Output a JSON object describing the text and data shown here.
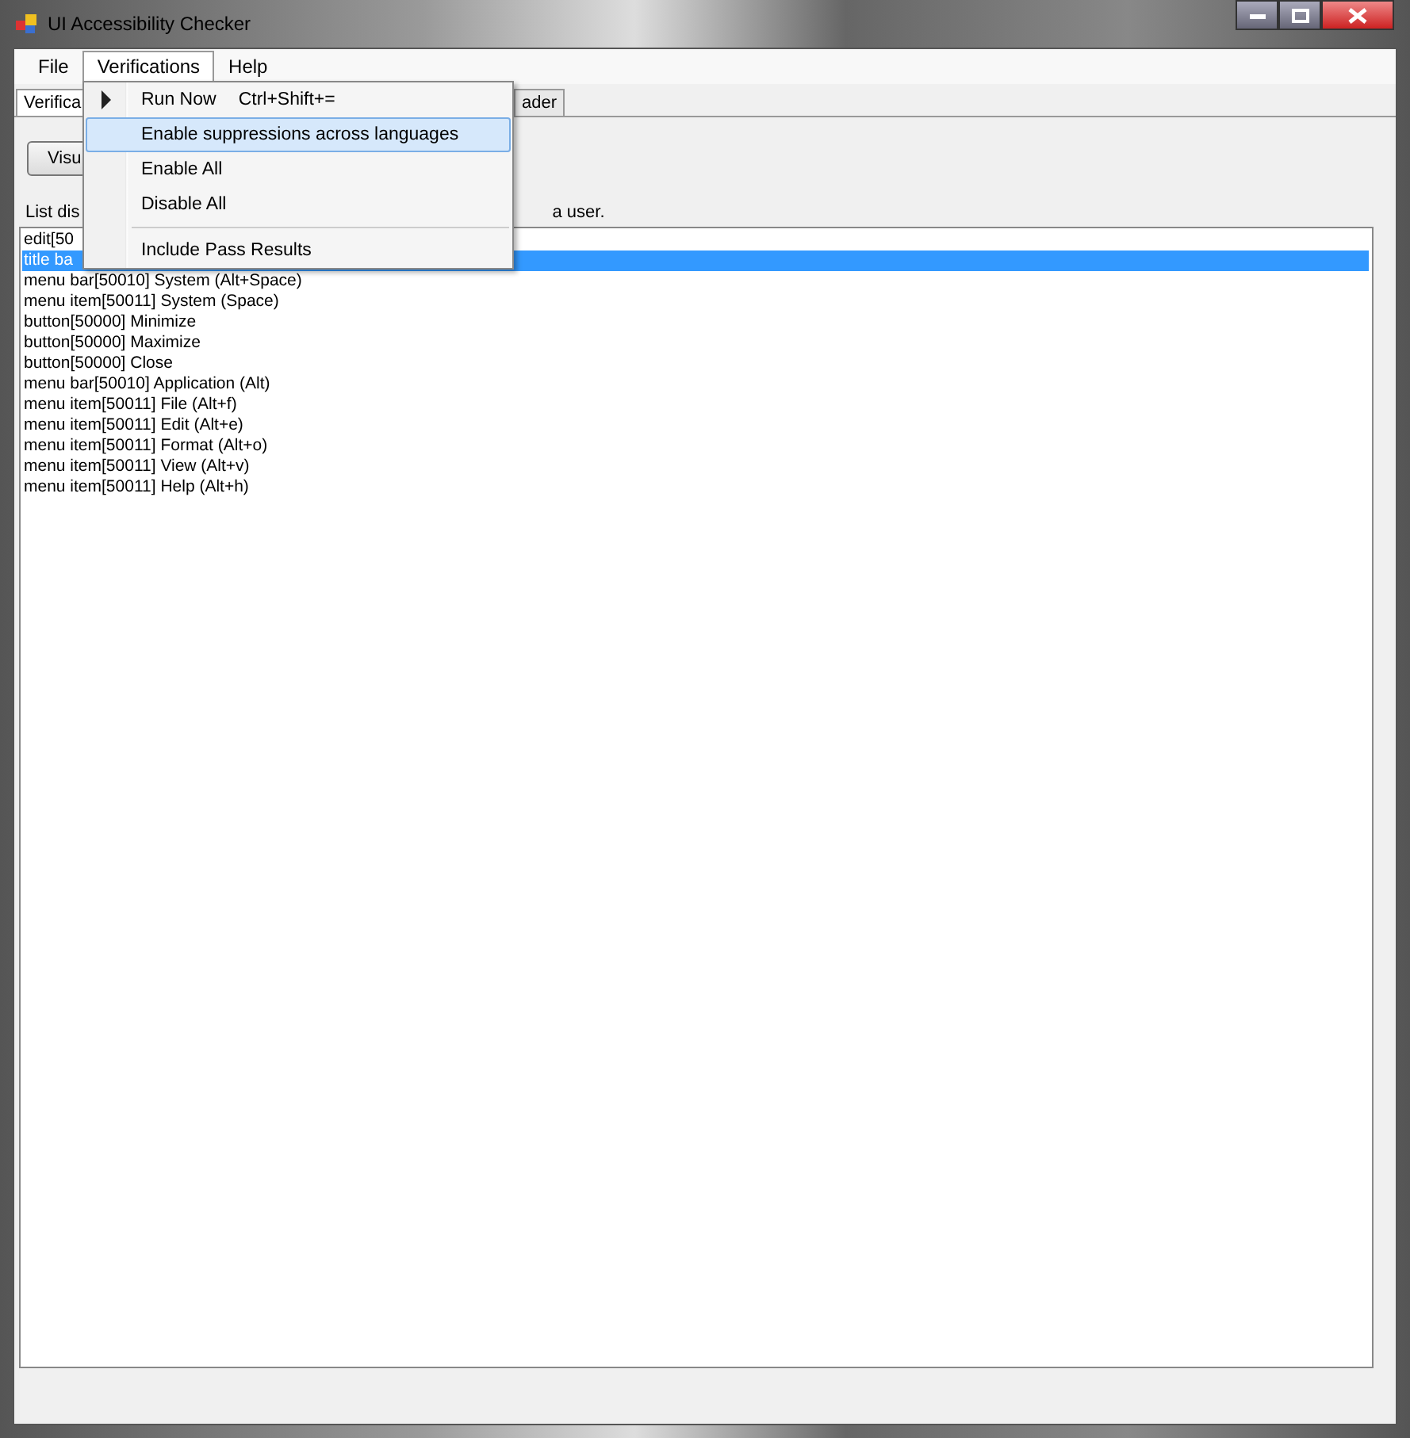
{
  "window": {
    "title": "UI Accessibility Checker"
  },
  "menu_bar": [
    {
      "label": "File",
      "selected": false
    },
    {
      "label": "Verifications",
      "selected": true
    },
    {
      "label": "Help",
      "selected": false
    }
  ],
  "dropdown": [
    {
      "kind": "item",
      "label": "Run Now",
      "shortcut": "Ctrl+Shift+=",
      "arrow": true,
      "selected": false
    },
    {
      "kind": "item",
      "label": "Enable suppressions across languages",
      "selected": true
    },
    {
      "kind": "item",
      "label": "Enable All",
      "selected": false
    },
    {
      "kind": "item",
      "label": "Disable All",
      "selected": false
    },
    {
      "kind": "separator"
    },
    {
      "kind": "item",
      "label": "Include Pass Results",
      "selected": false
    }
  ],
  "tabs": [
    {
      "label": "Verifica",
      "selected": true
    },
    {
      "label": "ader",
      "selected": false
    }
  ],
  "button": "Visu",
  "description": {
    "left": "List dis",
    "right": "a user."
  },
  "list": [
    {
      "text": "edit[50",
      "selected": false
    },
    {
      "text": "title ba",
      "selected": true
    },
    {
      "text": "menu bar[50010] System (Alt+Space)",
      "selected": false
    },
    {
      "text": "menu item[50011] System (Space)",
      "selected": false
    },
    {
      "text": "button[50000] Minimize",
      "selected": false
    },
    {
      "text": "button[50000] Maximize",
      "selected": false
    },
    {
      "text": "button[50000] Close",
      "selected": false
    },
    {
      "text": "menu bar[50010] Application (Alt)",
      "selected": false
    },
    {
      "text": "menu item[50011] File (Alt+f)",
      "selected": false
    },
    {
      "text": "menu item[50011] Edit (Alt+e)",
      "selected": false
    },
    {
      "text": "menu item[50011] Format (Alt+o)",
      "selected": false
    },
    {
      "text": "menu item[50011] View (Alt+v)",
      "selected": false
    },
    {
      "text": "menu item[50011] Help (Alt+h)",
      "selected": false
    }
  ]
}
